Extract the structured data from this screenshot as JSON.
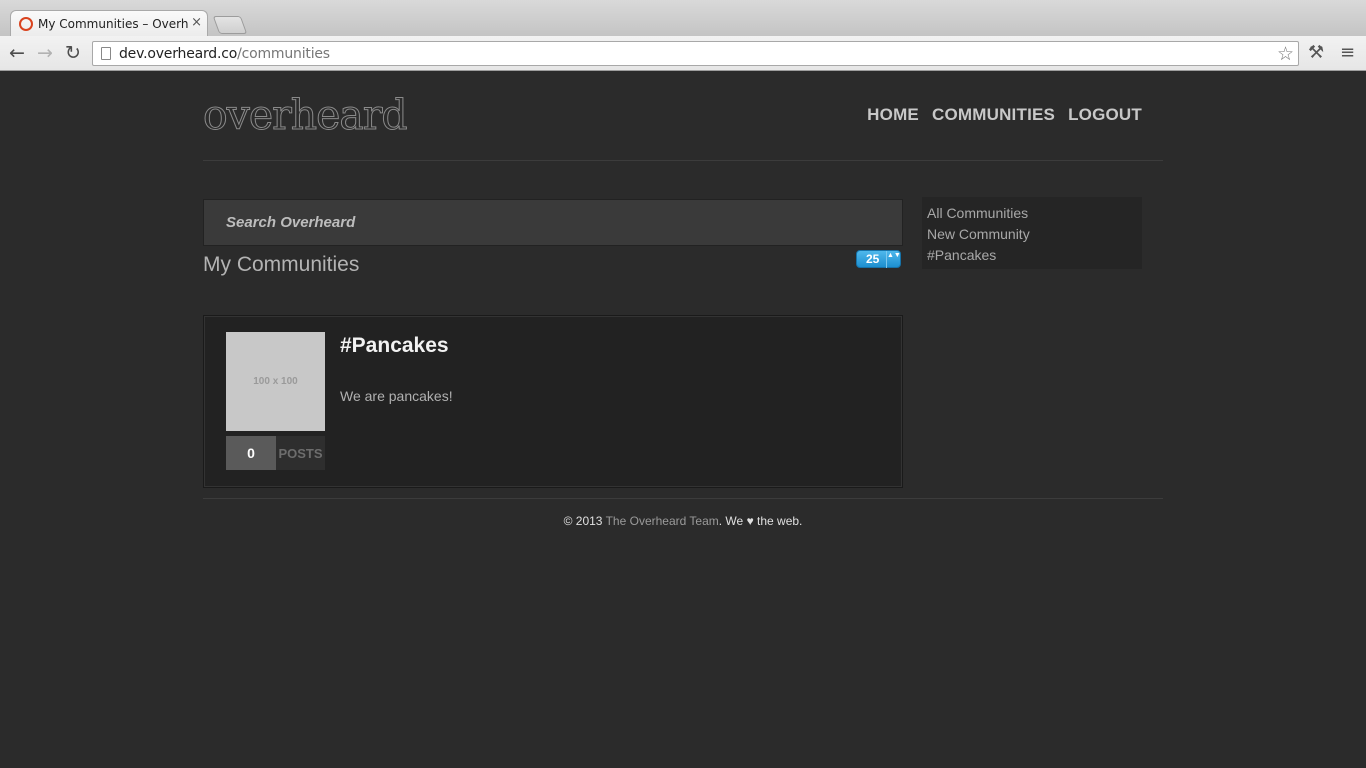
{
  "browser": {
    "tab_title": "My Communities – Overheard",
    "tab_close": "×",
    "url_host": "dev.overheard.co",
    "url_path": "/communities",
    "back_icon": "←",
    "forward_icon": "→",
    "reload_icon": "↻",
    "star_icon": "☆",
    "wrench_icon": "⚒",
    "menu_icon": "≡"
  },
  "site": {
    "logo": "overheard",
    "nav": [
      "HOME",
      "COMMUNITIES",
      "LOGOUT"
    ]
  },
  "search": {
    "placeholder": "Search Overheard"
  },
  "main": {
    "heading": "My Communities",
    "per_page": "25",
    "per_page_arrows": "▲▼"
  },
  "sidebar": {
    "items": [
      "All Communities",
      "New Community",
      "#Pancakes"
    ]
  },
  "communities": [
    {
      "thumb_label": "100 x 100",
      "post_count": "0",
      "post_label": "POSTS",
      "title": "#Pancakes",
      "description": "We are pancakes!"
    }
  ],
  "footer": {
    "copyright": "© 2013",
    "team": "The Overheard Team",
    "we": ". We",
    "heart": "♥",
    "rest": "the web."
  },
  "colors": {
    "background": "#2b2b2b",
    "accent": "#1d8fd0"
  }
}
